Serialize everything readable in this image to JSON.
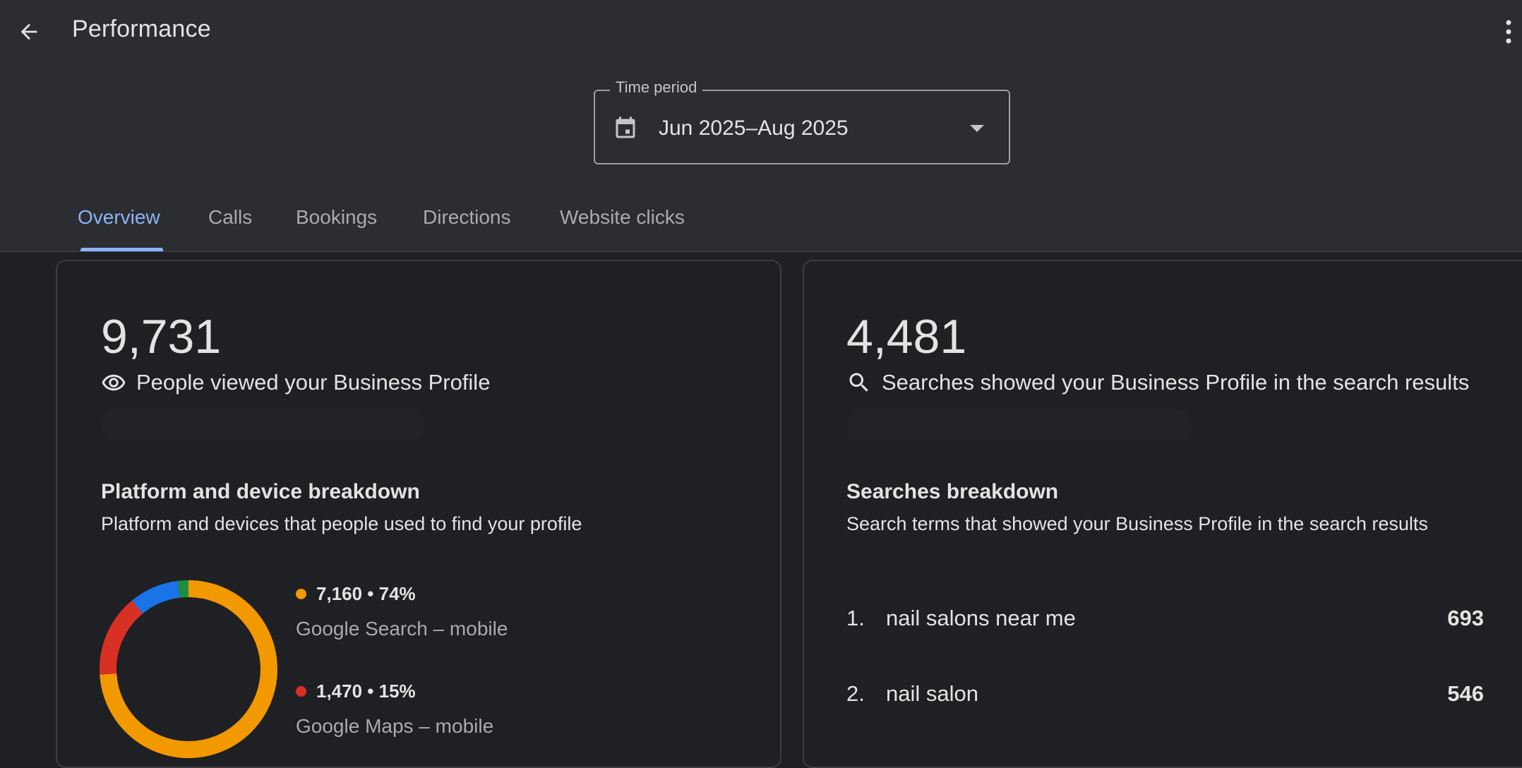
{
  "header": {
    "title": "Performance"
  },
  "time_period": {
    "label": "Time period",
    "value": "Jun 2025–Aug 2025"
  },
  "tabs": [
    {
      "label": "Overview",
      "active": true
    },
    {
      "label": "Calls",
      "active": false
    },
    {
      "label": "Bookings",
      "active": false
    },
    {
      "label": "Directions",
      "active": false
    },
    {
      "label": "Website clicks",
      "active": false
    }
  ],
  "profile_views": {
    "count": "9,731",
    "label": "People viewed your Business Profile",
    "icon": "eye-icon"
  },
  "platform_breakdown": {
    "title": "Platform and device breakdown",
    "subtitle": "Platform and devices that people used to find your profile",
    "items": [
      {
        "value": "7,160 • 74%",
        "label": "Google Search – mobile",
        "color": "#f29900",
        "share": 0.74
      },
      {
        "value": "1,470 • 15%",
        "label": "Google Maps – mobile",
        "color": "#d93025",
        "share": 0.15
      }
    ],
    "other_segments": [
      {
        "color": "#1a73e8",
        "share": 0.09
      },
      {
        "color": "#1e8e3e",
        "share": 0.02
      }
    ]
  },
  "search_appearances": {
    "count": "4,481",
    "label": "Searches showed your Business Profile in the search results",
    "icon": "search-icon"
  },
  "searches_breakdown": {
    "title": "Searches breakdown",
    "subtitle": "Search terms that showed your Business Profile in the search results",
    "items": [
      {
        "rank": "1.",
        "term": "nail salons near me",
        "count": "693"
      },
      {
        "rank": "2.",
        "term": "nail salon",
        "count": "546"
      }
    ]
  }
}
